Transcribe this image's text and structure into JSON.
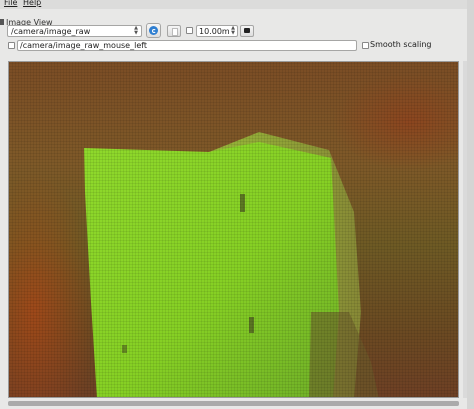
{
  "menubar": {
    "file": "File",
    "help": "Help"
  },
  "window": {
    "title": "Image View"
  },
  "toolbar": {
    "topic": "/camera/image_raw",
    "range_value": "10.00m",
    "refresh_icon": "refresh-icon",
    "save_icon": "save-icon"
  },
  "mouse": {
    "topic": "/camera/image_raw_mouse_left",
    "smooth_scaling_label": "Smooth scaling"
  },
  "colors": {
    "object_green": "#86d024",
    "background_brown": "#7e5928",
    "accent_blue": "#2f7fd1"
  }
}
